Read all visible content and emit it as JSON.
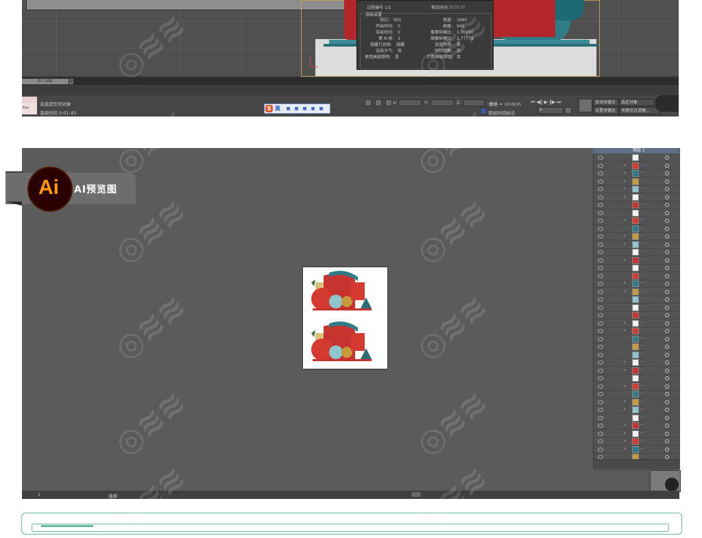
{
  "top_viewport": {
    "render_panel": {
      "process_label": "过程编号 1/1",
      "remaining_label": "剩余时间 ??:??:??",
      "section_title": "渲染设置",
      "left_rows": [
        {
          "label": "视口",
          "value": "001"
        },
        {
          "label": "开始时间",
          "value": "0"
        },
        {
          "label": "结束时间",
          "value": "0"
        },
        {
          "label": "第 N 帧",
          "value": "1"
        },
        {
          "label": "隐藏几何体",
          "value": "隐藏"
        },
        {
          "label": "渲染大气",
          "value": "否"
        },
        {
          "label": "使用高级照明",
          "value": "是"
        }
      ],
      "right_rows": [
        {
          "label": "宽度",
          "value": "1680"
        },
        {
          "label": "高度",
          "value": "945"
        },
        {
          "label": "像素纵横比",
          "value": "1.00000"
        },
        {
          "label": "图像纵横比",
          "value": "1.77778"
        },
        {
          "label": "渲染为场",
          "value": "否"
        },
        {
          "label": "强制双面",
          "value": "否"
        },
        {
          "label": "计算高级照明",
          "value": "否"
        }
      ]
    },
    "time_slider": "0 / 100",
    "time_arrow": ">"
  },
  "status_bar": {
    "for_all": "For All",
    "selection_status": "未选定任何对象",
    "render_time": "渲染时间  0:01:45",
    "ime_label": "英",
    "ime_logo": "S",
    "x_label": "X:",
    "y_label": "Y:",
    "z_label": "Z:",
    "grid_label": "栅格 = 10.0cm",
    "add_time_tag": "添加时间标记",
    "auto_key": "自动关键点",
    "set_key": "设置关键点",
    "selected_object": "选定对象",
    "key_filter": "关键点过滤器...",
    "frame_value": "0"
  },
  "ai_panel": {
    "banner_logo": "Ai",
    "banner_label": "AI预览图",
    "layer_name": "图层 1",
    "bottom_zoom": "1",
    "bottom_status": "选择"
  },
  "colors": {
    "ai_orange": "#ff9a00",
    "ai_dark": "#2b0000",
    "teal_border": "#6fb7a4"
  }
}
